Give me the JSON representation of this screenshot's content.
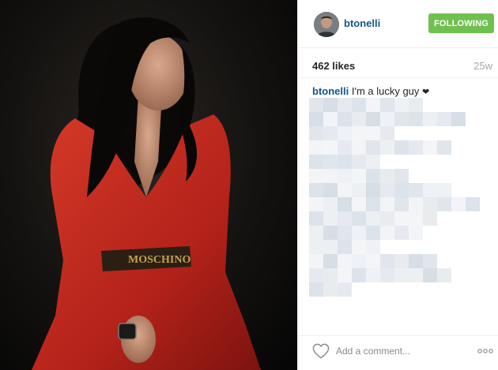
{
  "post": {
    "image_alt": "Woman in red outfit",
    "belt_text": "MOSCHINO"
  },
  "header": {
    "username": "btonelli",
    "follow_label": "FOLLOWING",
    "follow_color": "#70c050"
  },
  "stats": {
    "likes": "462 likes",
    "age": "25w"
  },
  "caption": {
    "username": "btonelli",
    "text": "I'm a lucky guy ",
    "emoji": "❤",
    "blurred": true
  },
  "footer": {
    "comment_placeholder": "Add a comment...",
    "like_icon": "heart-outline-icon",
    "more_icon": "ellipsis-icon"
  },
  "colors": {
    "link": "#125688",
    "muted": "#a5a7aa",
    "divider": "#efefef"
  }
}
